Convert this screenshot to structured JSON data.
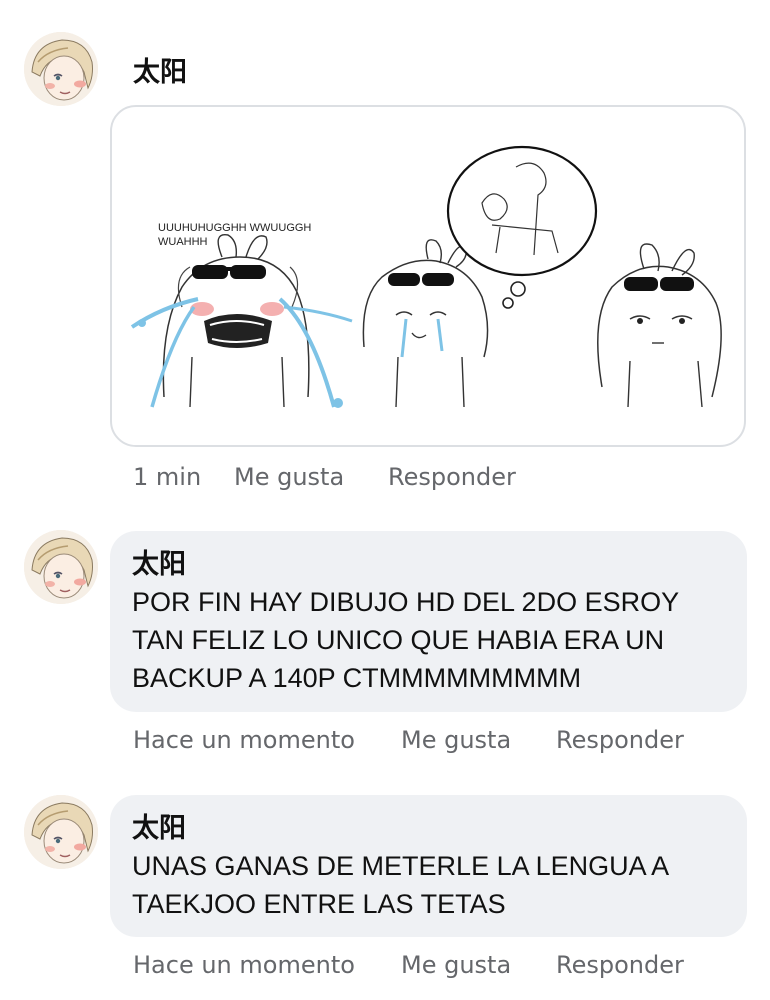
{
  "comments": [
    {
      "author": "太阳",
      "attachment": {
        "caption_line1": "UUUHUHUGGHH WWUUGGH",
        "caption_line2": "WUAHHH"
      },
      "time": "1 min",
      "like_label": "Me gusta",
      "reply_label": "Responder"
    },
    {
      "author": "太阳",
      "text_lines": [
        "POR FIN HAY DIBUJO HD DEL 2DO ESROY",
        "TAN FELIZ LO UNICO QUE HABIA ERA UN",
        "BACKUP A 140P CTMMMMMMMMM"
      ],
      "time": "Hace un momento",
      "like_label": "Me gusta",
      "reply_label": "Responder"
    },
    {
      "author": "太阳",
      "text_lines": [
        "UNAS GANAS DE METERLE LA LENGUA A",
        "TAEKJOO ENTRE LAS TETAS"
      ],
      "time": "Hace un momento",
      "like_label": "Me gusta",
      "reply_label": "Responder"
    }
  ],
  "colors": {
    "bubble_bg": "#eff1f4",
    "meta_text": "#65676b",
    "tears": "#7ec3e6"
  }
}
